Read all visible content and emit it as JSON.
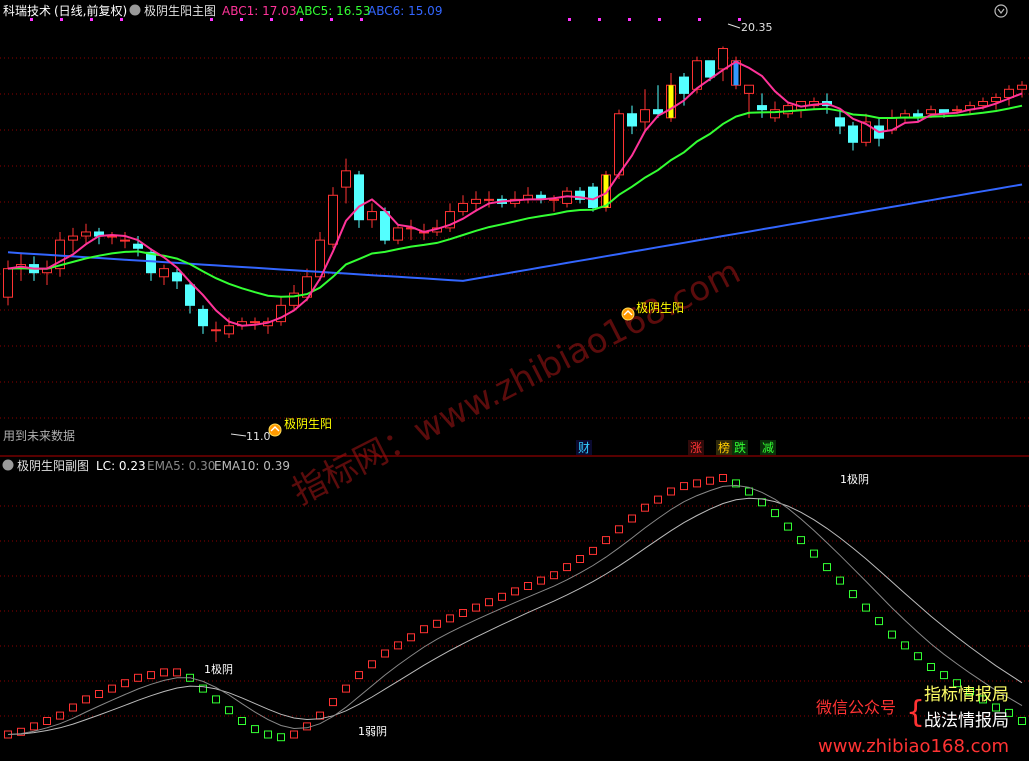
{
  "main_panel": {
    "stock_name": "科瑞技术",
    "period": "(日线,前复权)",
    "indicator_name": "极阴生阳主图",
    "legend": [
      {
        "label": "ABC1: 17.03",
        "color": "#ff3399"
      },
      {
        "label": "ABC5: 16.53",
        "color": "#33ff33"
      },
      {
        "label": "ABC6: 15.09",
        "color": "#3366ff"
      }
    ],
    "high_label": "20.35",
    "low_label": "11.0",
    "signal_label": "极阴生阳",
    "future_data_label": "用到未来数据",
    "event_tags": [
      {
        "text": "财",
        "color": "#33ccff"
      },
      {
        "text": "涨",
        "color": "#ff3333"
      },
      {
        "text": "榜",
        "color": "#ffcc00"
      },
      {
        "text": "跌",
        "color": "#33ff33"
      },
      {
        "text": "减",
        "color": "#33ff33"
      }
    ]
  },
  "sub_panel": {
    "indicator_name": "极阴生阳副图",
    "lc_label": "LC: 0.23",
    "ema5_label": "EMA5: 0.30",
    "ema10_label": "EMA10: 0.39",
    "markers": [
      "1极阴",
      "1弱阴",
      "1极阴"
    ]
  },
  "watermark": {
    "diagonal": "指标网：www.zhibiao168.com",
    "line1_left": "微信公众号",
    "line1_right": "指标情报局",
    "line2_right": "战法情报局",
    "url": "www.zhibiao168.com"
  },
  "colors": {
    "up": "#ff3333",
    "down": "#54ffff",
    "abc1": "#ff3399",
    "abc5": "#33ff33",
    "abc6": "#3366ff",
    "grid": "#8b0000",
    "signal": "#ffff00"
  },
  "chart_data": {
    "type": "candlestick",
    "candles": [
      [
        14.2,
        14.9,
        14.0,
        15.1
      ],
      [
        14.9,
        15.0,
        14.6,
        15.3
      ],
      [
        15.0,
        14.8,
        14.6,
        15.2
      ],
      [
        14.8,
        14.9,
        14.5,
        15.1
      ],
      [
        14.9,
        15.6,
        14.7,
        15.8
      ],
      [
        15.6,
        15.7,
        15.3,
        15.9
      ],
      [
        15.7,
        15.8,
        15.5,
        16.0
      ],
      [
        15.8,
        15.7,
        15.5,
        15.9
      ],
      [
        15.7,
        15.7,
        15.5,
        15.8
      ],
      [
        15.6,
        15.6,
        15.4,
        15.8
      ],
      [
        15.5,
        15.4,
        15.2,
        15.7
      ],
      [
        15.3,
        14.8,
        14.6,
        15.4
      ],
      [
        14.7,
        14.9,
        14.5,
        15.0
      ],
      [
        14.8,
        14.6,
        14.4,
        14.9
      ],
      [
        14.5,
        14.0,
        13.8,
        14.6
      ],
      [
        13.9,
        13.5,
        13.3,
        14.0
      ],
      [
        13.4,
        13.4,
        13.1,
        13.6
      ],
      [
        13.3,
        13.5,
        13.2,
        13.7
      ],
      [
        13.5,
        13.6,
        13.4,
        13.7
      ],
      [
        13.6,
        13.6,
        13.4,
        13.7
      ],
      [
        13.5,
        13.6,
        13.3,
        13.7
      ],
      [
        13.6,
        14.0,
        13.5,
        14.2
      ],
      [
        14.0,
        14.3,
        13.9,
        14.5
      ],
      [
        14.2,
        14.7,
        14.1,
        14.9
      ],
      [
        14.7,
        15.6,
        14.6,
        15.8
      ],
      [
        15.5,
        16.7,
        15.4,
        16.9
      ],
      [
        16.9,
        17.3,
        16.5,
        17.6
      ],
      [
        17.2,
        16.1,
        15.9,
        17.3
      ],
      [
        16.1,
        16.3,
        15.9,
        16.5
      ],
      [
        16.3,
        15.6,
        15.5,
        16.4
      ],
      [
        15.6,
        15.9,
        15.5,
        16.0
      ],
      [
        15.9,
        15.9,
        15.6,
        16.1
      ],
      [
        15.8,
        15.8,
        15.6,
        16.0
      ],
      [
        15.8,
        15.9,
        15.7,
        16.1
      ],
      [
        15.9,
        16.3,
        15.8,
        16.5
      ],
      [
        16.3,
        16.5,
        16.2,
        16.7
      ],
      [
        16.5,
        16.6,
        16.3,
        16.8
      ],
      [
        16.6,
        16.6,
        16.4,
        16.8
      ],
      [
        16.6,
        16.5,
        16.4,
        16.7
      ],
      [
        16.5,
        16.6,
        16.4,
        16.8
      ],
      [
        16.6,
        16.7,
        16.5,
        16.9
      ],
      [
        16.7,
        16.6,
        16.5,
        16.8
      ],
      [
        16.6,
        16.6,
        16.3,
        16.7
      ],
      [
        16.5,
        16.8,
        16.4,
        16.9
      ],
      [
        16.8,
        16.6,
        16.5,
        16.9
      ],
      [
        16.9,
        16.4,
        16.3,
        17.0
      ],
      [
        16.4,
        17.2,
        16.3,
        17.3
      ],
      [
        17.2,
        18.7,
        17.1,
        18.8
      ],
      [
        18.7,
        18.4,
        18.2,
        18.9
      ],
      [
        18.5,
        18.8,
        18.3,
        19.3
      ],
      [
        18.8,
        18.7,
        18.6,
        19.4
      ],
      [
        18.6,
        19.4,
        18.5,
        19.7
      ],
      [
        19.6,
        19.2,
        18.9,
        19.7
      ],
      [
        19.3,
        20.0,
        19.2,
        20.1
      ],
      [
        20.0,
        19.6,
        19.5,
        20.0
      ],
      [
        19.8,
        20.3,
        19.5,
        20.35
      ],
      [
        19.4,
        20.0,
        19.3,
        20.1
      ],
      [
        19.2,
        19.4,
        18.6,
        19.4
      ],
      [
        18.9,
        18.8,
        18.6,
        19.2
      ],
      [
        18.6,
        18.8,
        18.5,
        19.0
      ],
      [
        18.7,
        18.9,
        18.6,
        19.0
      ],
      [
        18.8,
        19.0,
        18.6,
        19.0
      ],
      [
        18.9,
        19.0,
        18.8,
        19.1
      ],
      [
        19.0,
        18.9,
        18.7,
        19.2
      ],
      [
        18.6,
        18.4,
        18.2,
        18.8
      ],
      [
        18.4,
        18.0,
        17.8,
        18.5
      ],
      [
        18.0,
        18.5,
        17.9,
        18.7
      ],
      [
        18.4,
        18.1,
        17.9,
        18.6
      ],
      [
        18.3,
        18.6,
        18.2,
        18.8
      ],
      [
        18.6,
        18.7,
        18.5,
        18.8
      ],
      [
        18.7,
        18.6,
        18.5,
        18.8
      ],
      [
        18.7,
        18.8,
        18.6,
        18.9
      ],
      [
        18.8,
        18.7,
        18.6,
        18.8
      ],
      [
        18.8,
        18.8,
        18.7,
        18.9
      ],
      [
        18.8,
        18.9,
        18.7,
        19.0
      ],
      [
        18.9,
        19.0,
        18.8,
        19.1
      ],
      [
        19.0,
        19.1,
        18.8,
        19.2
      ],
      [
        19.1,
        19.3,
        18.9,
        19.4
      ],
      [
        19.3,
        19.4,
        19.1,
        19.5
      ]
    ]
  }
}
